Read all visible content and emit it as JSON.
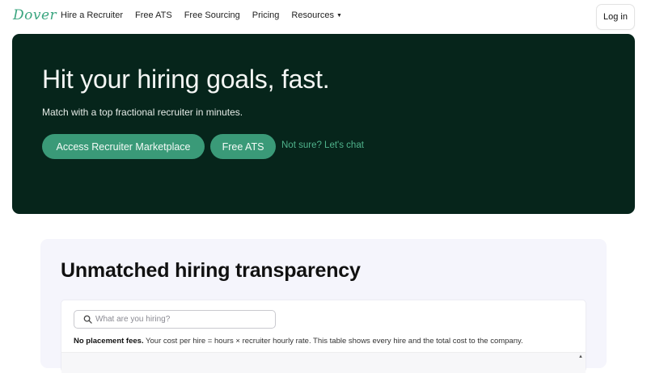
{
  "nav": {
    "logo": "Dover",
    "links": [
      "Hire a Recruiter",
      "Free ATS",
      "Free Sourcing",
      "Pricing",
      "Resources"
    ],
    "resources_caret": "▼",
    "login": "Log in"
  },
  "hero": {
    "title": "Hit your hiring goals, fast.",
    "subtitle": "Match with a top fractional recruiter in minutes.",
    "primary_button": "Access Recruiter Marketplace",
    "secondary_button": "Free ATS",
    "chat_link": "Not sure? Let's chat"
  },
  "transparency": {
    "title": "Unmatched hiring transparency",
    "search_placeholder": "What are you hiring?",
    "search_value": "",
    "note_bold": "No placement fees.",
    "note_text": " Your cost per hire = hours × recruiter hourly rate. This table shows every hire and the total cost to the company."
  },
  "colors": {
    "brand_green": "#3aa57f",
    "hero_bg": "#06251b",
    "button_green": "#3a9a78",
    "link_green": "#4fb38c",
    "section_bg": "#f5f5fc"
  },
  "icons": [
    "search-icon",
    "chevron-down-icon",
    "scroll-up-arrow-icon"
  ]
}
